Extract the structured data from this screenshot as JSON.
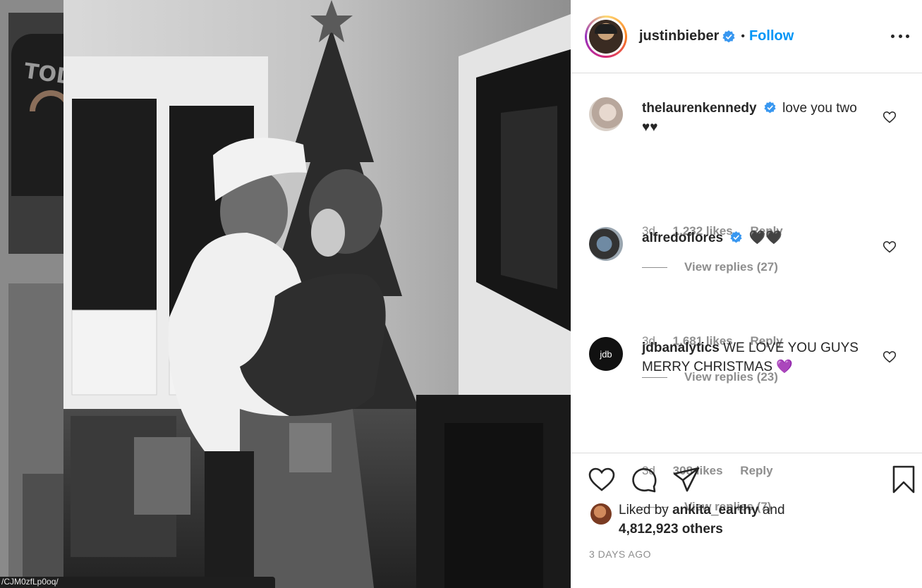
{
  "post": {
    "username": "justinbieber",
    "follow_label": "Follow",
    "separator": "•",
    "photo_alt": "Christmas photo"
  },
  "comments": [
    {
      "user": "thelaurenkennedy",
      "verified": true,
      "text": "love you two ♥♥",
      "age": "3d",
      "likes": "1,232 likes",
      "reply_label": "Reply",
      "replies": "View replies (27)"
    },
    {
      "user": "alfredoflores",
      "verified": true,
      "text": "🖤🖤",
      "age": "3d",
      "likes": "1,681 likes",
      "reply_label": "Reply",
      "replies": "View replies (23)"
    },
    {
      "user": "jdbanalytics",
      "verified": false,
      "text": "WE LOVE YOU GUYS MERRY CHRISTMAS 💜",
      "age": "3d",
      "likes": "308 likes",
      "reply_label": "Reply",
      "replies": "View replies (7)",
      "avatar_text": "jdb"
    }
  ],
  "likes": {
    "prefix": "Liked by",
    "user": "ankita_earthy",
    "joiner": "and",
    "others": "4,812,923 others"
  },
  "date": "3 DAYS AGO",
  "status_bar_url": "/CJM0zfLp0oq/",
  "colors": {
    "accent": "#0095f6",
    "verified": "#3897f0",
    "text": "#262626",
    "muted": "#8e8e8e"
  },
  "icons": [
    "verified-badge-icon",
    "more-options-icon",
    "heart-icon",
    "comment-icon",
    "share-icon",
    "bookmark-icon"
  ]
}
